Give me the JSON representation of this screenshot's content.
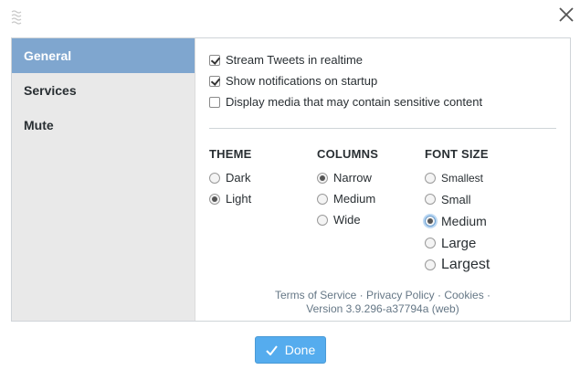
{
  "sidebar": {
    "items": [
      {
        "label": "General",
        "active": true
      },
      {
        "label": "Services",
        "active": false
      },
      {
        "label": "Mute",
        "active": false
      }
    ]
  },
  "general": {
    "checkboxes": [
      {
        "label": "Stream Tweets in realtime",
        "checked": true
      },
      {
        "label": "Show notifications on startup",
        "checked": true
      },
      {
        "label": "Display media that may contain sensitive content",
        "checked": false
      }
    ],
    "theme": {
      "title": "THEME",
      "options": [
        {
          "label": "Dark",
          "selected": false
        },
        {
          "label": "Light",
          "selected": true
        }
      ]
    },
    "columns": {
      "title": "COLUMNS",
      "options": [
        {
          "label": "Narrow",
          "selected": true
        },
        {
          "label": "Medium",
          "selected": false
        },
        {
          "label": "Wide",
          "selected": false
        }
      ]
    },
    "font_size": {
      "title": "FONT SIZE",
      "options": [
        {
          "label": "Smallest",
          "selected": false
        },
        {
          "label": "Small",
          "selected": false
        },
        {
          "label": "Medium",
          "selected": true
        },
        {
          "label": "Large",
          "selected": false
        },
        {
          "label": "Largest",
          "selected": false
        }
      ]
    }
  },
  "footer": {
    "links": [
      "Terms of Service",
      "Privacy Policy",
      "Cookies"
    ],
    "separator": " · ",
    "version": "Version 3.9.296-a37794a (web)"
  },
  "done_label": "Done",
  "colors": {
    "accent": "#55acee",
    "sidebar_active": "#7fa6cf",
    "sidebar_bg": "#e9e9e9"
  },
  "icons": {
    "drag": "drag-handle-icon",
    "close": "close-icon",
    "check": "checkmark-icon"
  }
}
